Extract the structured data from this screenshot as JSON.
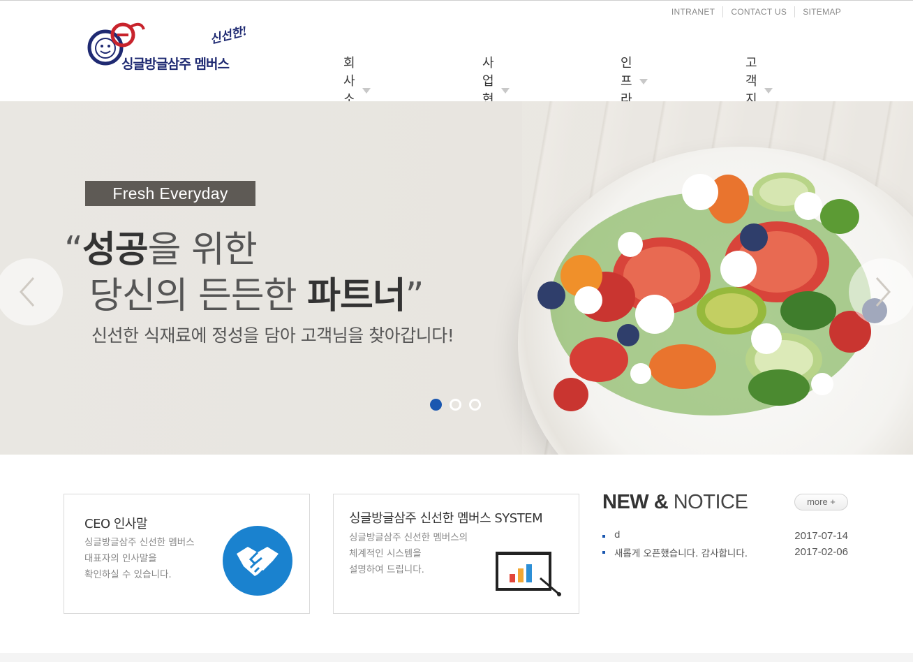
{
  "header": {
    "util_links": [
      "INTRANET",
      "CONTACT US",
      "SITEMAP"
    ],
    "logo": {
      "name": "싱글방글삼주 멤버스",
      "slogan": "신선한!"
    },
    "nav": [
      "회사소개",
      "사업현황",
      "인프라",
      "고객지원"
    ]
  },
  "hero": {
    "badge": "Fresh Everyday",
    "line1_quote_open": "“",
    "line1_bold": "성공",
    "line1_rest": "을 위한",
    "line2_plain": "당신의 든든한 ",
    "line2_bold": "파트너",
    "line2_quote_close": "”",
    "subline": "신선한 식재료에 정성을 담아 고객님을 찾아갑니다!",
    "slide_count": 3,
    "active_slide": 1
  },
  "cards": {
    "ceo": {
      "title": "CEO 인사말",
      "desc": [
        "싱글방글삼주 신선한 멤버스",
        "대표자의 인사말을",
        "확인하실 수 있습니다."
      ]
    },
    "system": {
      "title": "싱글방글삼주 신선한 멤버스 SYSTEM",
      "desc": [
        "싱글방글삼주 신선한 멤버스의",
        "체계적인 시스템을",
        "설명하여 드립니다."
      ]
    }
  },
  "notice": {
    "title_bold": "NEW &",
    "title_light": " NOTICE",
    "more_label": "more +",
    "items": [
      {
        "text": "d",
        "date": "2017-07-14"
      },
      {
        "text": "새롭게 오픈했습니다. 감사합니다.",
        "date": "2017-02-06"
      }
    ]
  },
  "colors": {
    "brand_navy": "#1f2a72",
    "brand_red": "#c8232c",
    "accent_blue": "#1a57b0",
    "ceo_icon_bg": "#1a82cf",
    "badge_bg": "#5e5a55"
  }
}
